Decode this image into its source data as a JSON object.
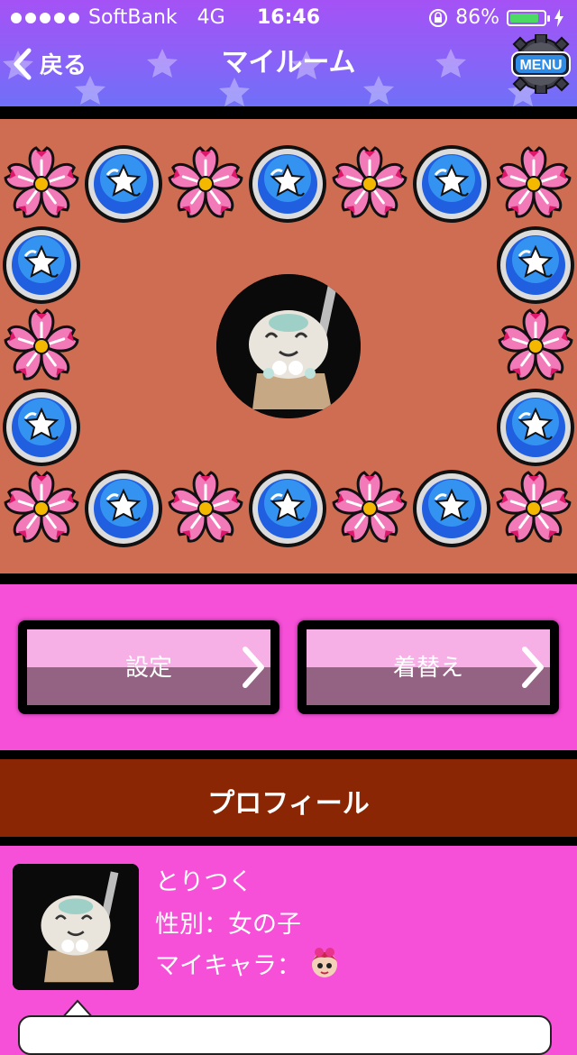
{
  "status_bar": {
    "carrier": "SoftBank",
    "network": "4G",
    "time": "16:46",
    "battery": "86%",
    "battery_level": 0.86
  },
  "nav": {
    "back_label": "戻る",
    "title": "マイルーム",
    "menu_label": "MENU"
  },
  "room": {
    "frame_icons": [
      "flower-icon",
      "blue-star-badge-icon"
    ],
    "avatar_icon": "avatar-photo"
  },
  "buttons": {
    "settings_label": "設定",
    "dressup_label": "着替え"
  },
  "profile": {
    "section_title": "プロフィール",
    "name": "とりつく",
    "gender_line": "性別：女の子",
    "mychara_line": "マイキャラ："
  },
  "colors": {
    "nav_gradient_top": "#a552f5",
    "nav_gradient_bottom": "#6f70f8",
    "background": "#f64fd8",
    "room_floor": "#cf6d52",
    "profile_bar": "#8a2603",
    "button_top": "#f6b0e6",
    "button_bottom": "#946383"
  }
}
